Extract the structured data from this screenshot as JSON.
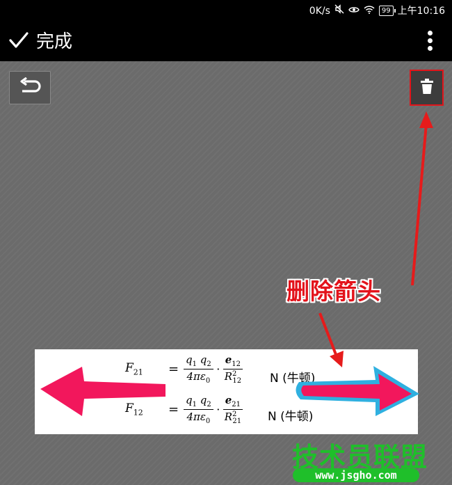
{
  "status_bar": {
    "network_speed": "0K/s",
    "battery_level": "99",
    "time": "上午10:16",
    "icons": [
      "mute-icon",
      "eye-icon",
      "wifi-icon",
      "battery-icon"
    ]
  },
  "toolbar": {
    "done_label": "完成",
    "done_icon": "checkmark-icon",
    "more_icon": "more-vertical-icon"
  },
  "canvas": {
    "undo_icon": "undo-icon",
    "delete_icon": "trash-icon",
    "delete_highlight_color": "#e2141a"
  },
  "annotation": {
    "label": "删除箭头",
    "label_color": "#e3131b"
  },
  "picture": {
    "formula1": {
      "lhs": "F",
      "lhs_sub": "21",
      "num1": "q",
      "num_a": "1",
      "num2": "q",
      "num_b": "2",
      "den": "4πε",
      "den_sub": "0",
      "vnum": "e",
      "vnum_sub": "12",
      "vden": "R",
      "vden_sup": "2",
      "vden_sub": "12",
      "unit": "N (牛顿)"
    },
    "formula2": {
      "lhs": "F",
      "lhs_sub": "12",
      "num1": "q",
      "num_a": "1",
      "num2": "q",
      "num_b": "2",
      "den": "4πε",
      "den_sub": "0",
      "vnum": "e",
      "vnum_sub": "21",
      "vden": "R",
      "vden_sup": "2",
      "vden_sub": "21",
      "unit": "N (牛顿)"
    },
    "left_arrow_color": "#f2175c",
    "right_arrow_color": "#f2175c",
    "right_arrow_outline": "#2fb0e0"
  },
  "watermark": {
    "text": "技术员联盟",
    "url": "www.jsgho.com",
    "color": "#1fbf2a"
  }
}
